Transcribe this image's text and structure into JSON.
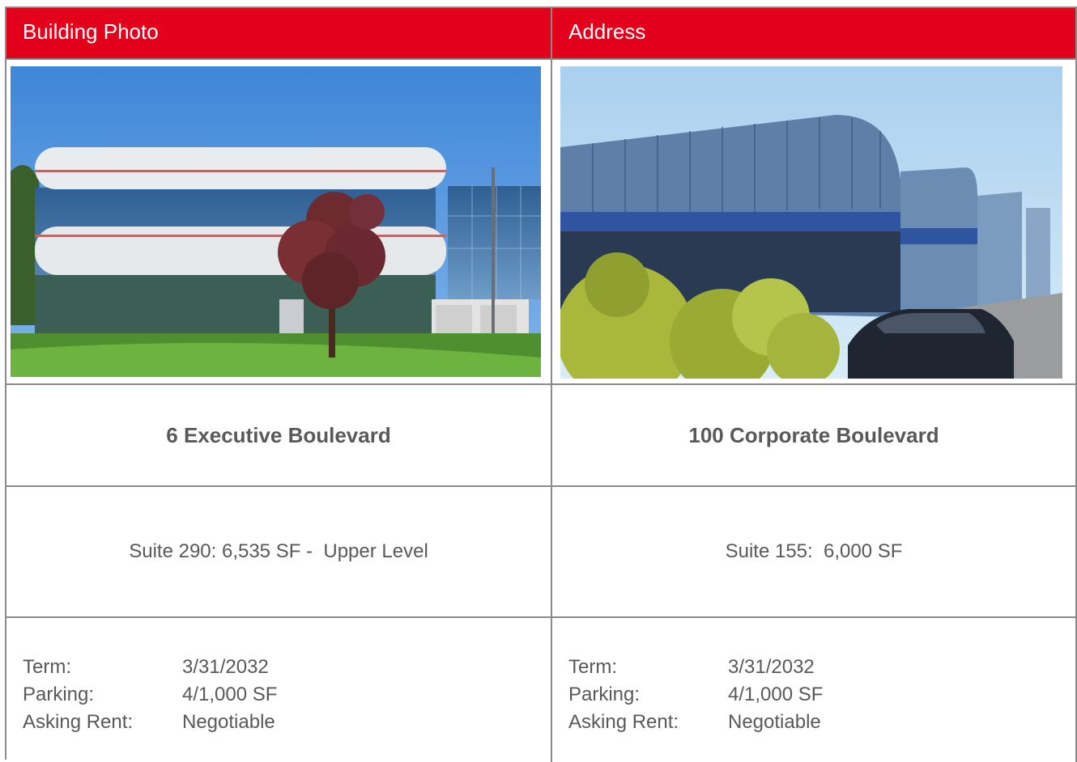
{
  "headers": {
    "col1": "Building Photo",
    "col2": "Address"
  },
  "buildings": [
    {
      "address": "6 Executive Boulevard",
      "suite": "Suite 290: 6,535 SF -  Upper Level",
      "details": [
        {
          "label": "Term:",
          "value": "3/31/2032"
        },
        {
          "label": "Parking:",
          "value": "4/1,000 SF"
        },
        {
          "label": "Asking Rent:",
          "value": "Negotiable"
        }
      ]
    },
    {
      "address": "100 Corporate  Boulevard",
      "suite": "Suite 155:  6,000 SF",
      "details": [
        {
          "label": "Term:",
          "value": "3/31/2032"
        },
        {
          "label": "Parking:",
          "value": "4/1,000 SF"
        },
        {
          "label": "Asking Rent:",
          "value": "Negotiable"
        }
      ]
    }
  ]
}
